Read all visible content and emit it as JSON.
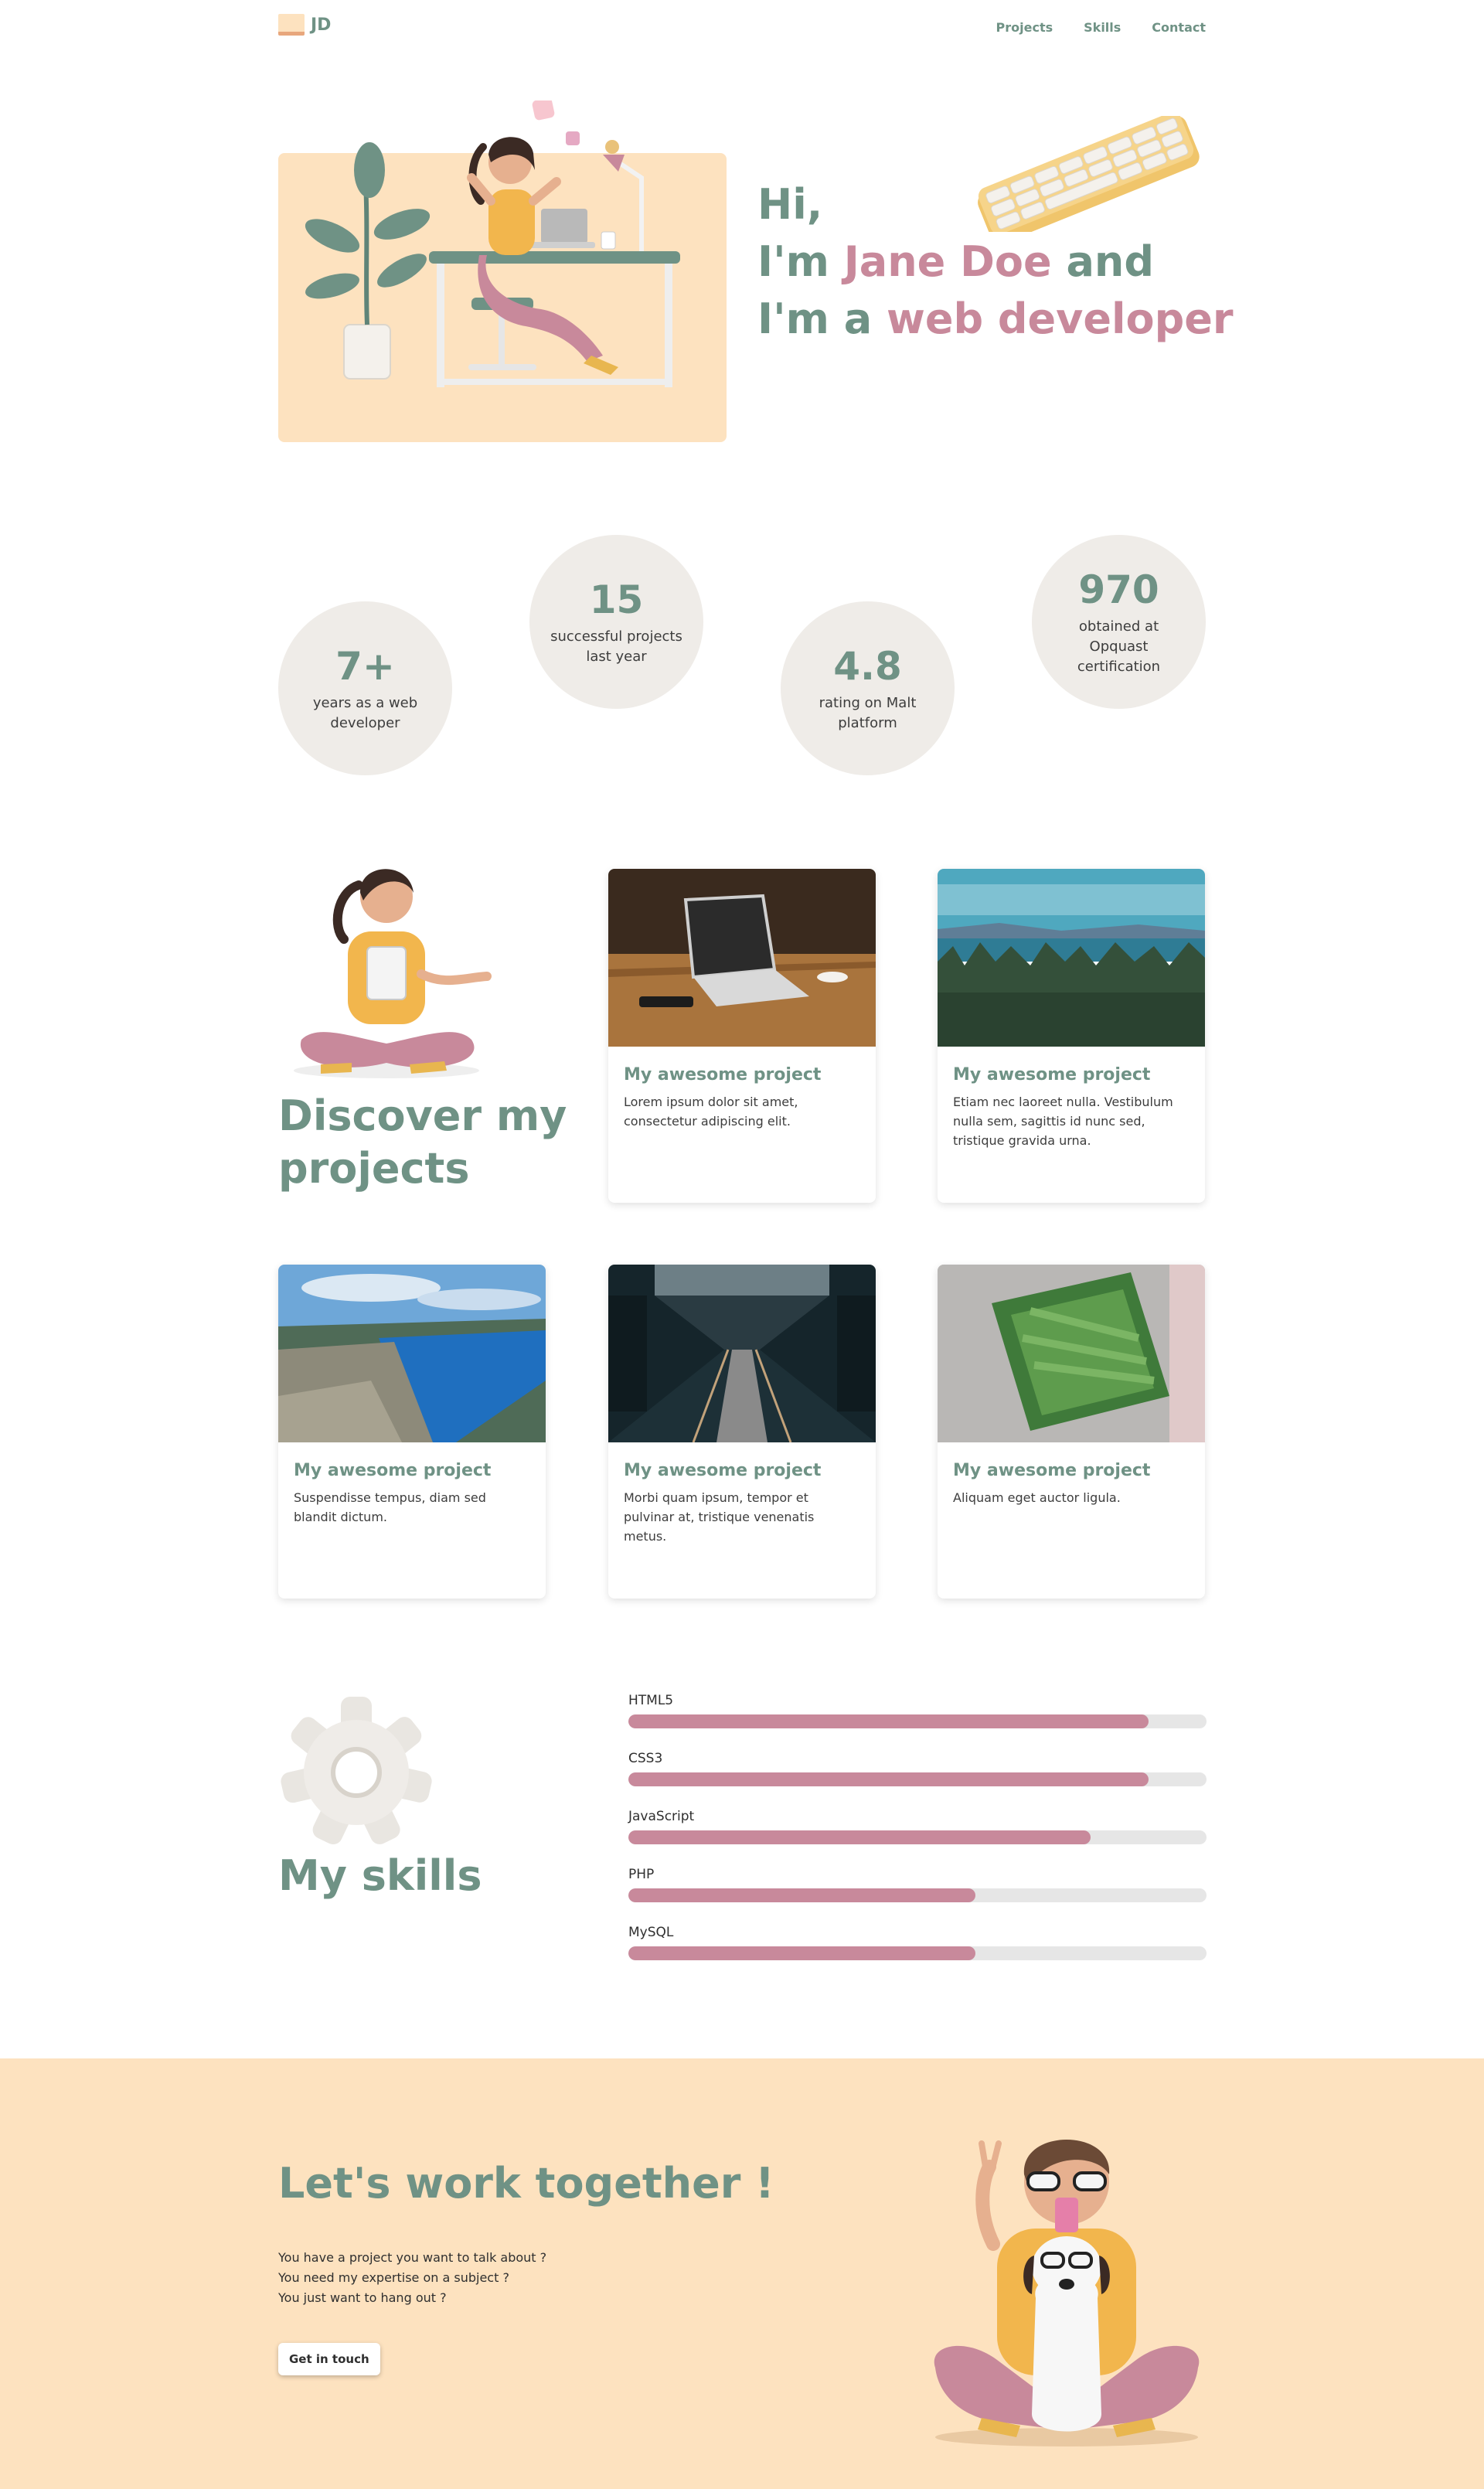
{
  "header": {
    "logo_text": "JD",
    "nav": [
      {
        "label": "Projects"
      },
      {
        "label": "Skills"
      },
      {
        "label": "Contact"
      }
    ]
  },
  "hero": {
    "line1": "Hi,",
    "line2_prefix": "I'm ",
    "line2_name": "Jane Doe",
    "line2_suffix": " and",
    "line3_prefix": "I'm a ",
    "line3_role": "web developer"
  },
  "stats": [
    {
      "value": "7+",
      "label": "years as a web developer"
    },
    {
      "value": "15",
      "label": "successful projects last year"
    },
    {
      "value": "4.8",
      "label": "rating on Malt platform"
    },
    {
      "value": "970",
      "label": "obtained at Opquast certification"
    }
  ],
  "projects": {
    "title": "Discover my projects",
    "cards": [
      {
        "title": "My awesome project",
        "text": "Lorem ipsum dolor sit amet, consectetur adipiscing elit.",
        "image_icon": "laptop-photo"
      },
      {
        "title": "My awesome project",
        "text": "Etiam nec laoreet nulla. Vestibulum nulla sem, sagittis id nunc sed, tristique gravida urna.",
        "image_icon": "forest-lake-photo"
      },
      {
        "title": "My awesome project",
        "text": "Suspendisse tempus, diam sed blandit dictum.",
        "image_icon": "fjord-photo"
      },
      {
        "title": "My awesome project",
        "text": "Morbi quam ipsum, tempor et pulvinar at, tristique venenatis metus.",
        "image_icon": "escalator-photo"
      },
      {
        "title": "My awesome project",
        "text": "Aliquam eget auctor ligula.",
        "image_icon": "stadium-photo"
      }
    ]
  },
  "skills": {
    "title": "My skills",
    "items": [
      {
        "name": "HTML5",
        "level": 0.9
      },
      {
        "name": "CSS3",
        "level": 0.9
      },
      {
        "name": "JavaScript",
        "level": 0.8
      },
      {
        "name": "PHP",
        "level": 0.6
      },
      {
        "name": "MySQL",
        "level": 0.6
      }
    ]
  },
  "contact": {
    "title": "Let's work together !",
    "lines": [
      "You have a project you want to talk about ?",
      "You need my expertise on a subject ?",
      "You just want to hang out ?"
    ],
    "button_label": "Get in touch"
  },
  "colors": {
    "primary": "#6f9285",
    "accent": "#c8899b",
    "peach": "#fde2bf",
    "stat_bg": "#efece8"
  }
}
